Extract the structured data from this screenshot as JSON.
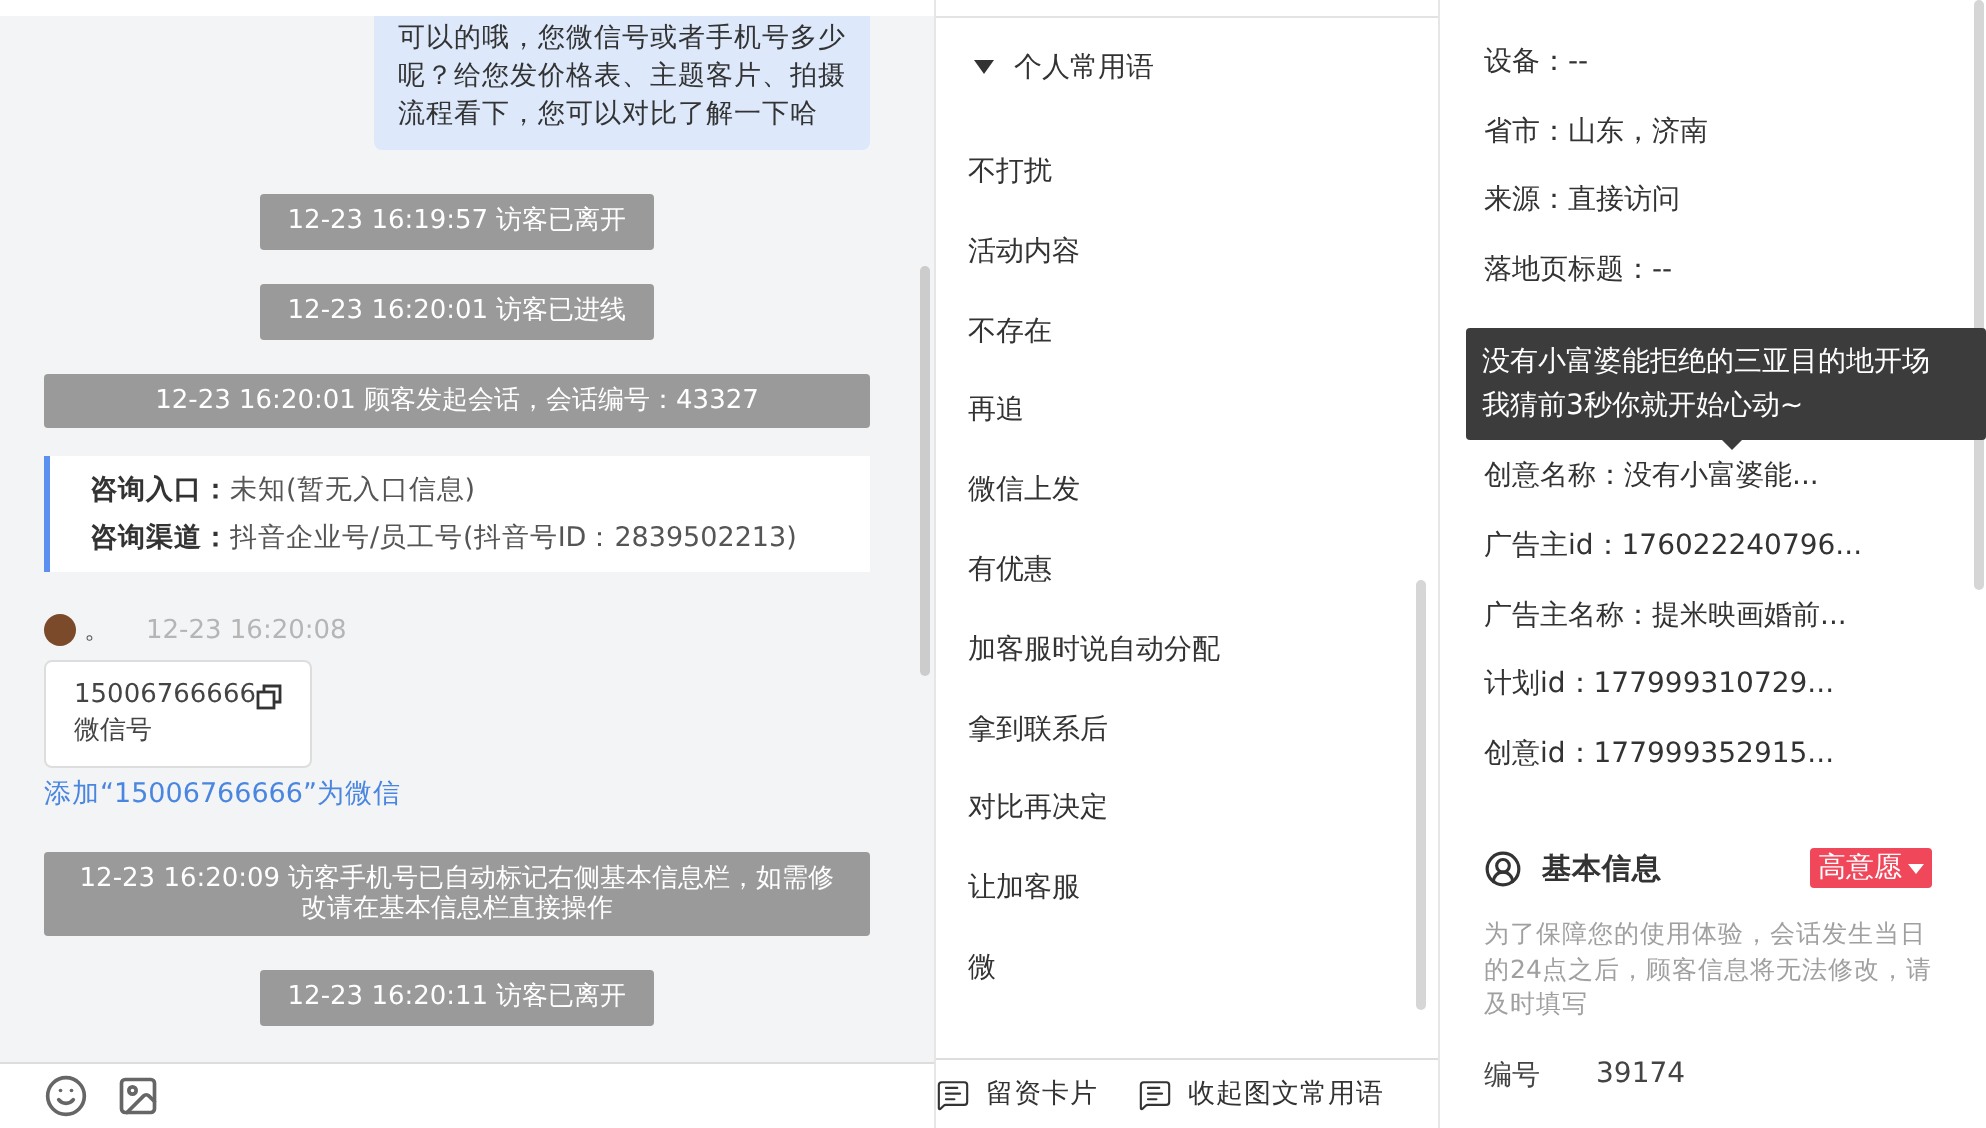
{
  "chat": {
    "messages": [
      {
        "kind": "agent_bubble",
        "text": "可以的哦，您微信号或者手机号多少呢？给您发价格表、主题客片、拍摄流程看下，您可以对比了解一下哈"
      },
      {
        "kind": "notice",
        "text": "12-23 16:19:57 访客已离开"
      },
      {
        "kind": "notice",
        "text": "12-23 16:20:01 访客已进线"
      },
      {
        "kind": "notice",
        "text": "12-23 16:20:01 顾客发起会话，会话编号：43327"
      },
      {
        "kind": "info_card",
        "lines": [
          {
            "label": "咨询入口：",
            "value": "未知(暂无入口信息)"
          },
          {
            "label": "咨询渠道：",
            "value": "抖音企业号/员工号(抖音号ID：2839502213)"
          }
        ]
      },
      {
        "kind": "visitor_card",
        "sender": "。",
        "time": "12-23 16:20:08",
        "number": "15006766666",
        "caption": "微信号",
        "link": "添加“15006766666”为微信"
      },
      {
        "kind": "notice",
        "text": "12-23 16:20:09 访客手机号已自动标记右侧基本信息栏，如需修改请在基本信息栏直接操作"
      },
      {
        "kind": "notice",
        "text": "12-23 16:20:11 访客已离开"
      }
    ]
  },
  "phrases": {
    "group": {
      "title": "个人常用语",
      "expanded": true
    },
    "items": [
      "不打扰",
      "活动内容",
      "不存在",
      "再追",
      "微信上发",
      "有优惠",
      "加客服时说自动分配",
      "拿到联系后",
      "对比再决定",
      "让加客服",
      "微"
    ],
    "footer_buttons": [
      "留资卡片",
      "收起图文常用语"
    ]
  },
  "source_info": {
    "rows": [
      "设备：--",
      "省市：山东，济南",
      "来源：直接访问",
      "落地页标题：--"
    ],
    "rows_after_tooltip": [
      "创意名称：没有小富婆能...",
      "广告主id：176022240796...",
      "广告主名称：提米映画婚前...",
      "计划id：177999310729...",
      "创意id：177999352915..."
    ],
    "tooltip": [
      "没有小富婆能拒绝的三亚目的地开场",
      "我猜前3秒你就开始心动~"
    ]
  },
  "basic_info": {
    "title": "基本信息",
    "intent_tag": "高意愿",
    "note": "为了保障您的使用体验，会话发生当日的24点之后，顾客信息将无法修改，请及时填写",
    "fields": [
      {
        "label": "编号",
        "value": "39174"
      }
    ]
  }
}
